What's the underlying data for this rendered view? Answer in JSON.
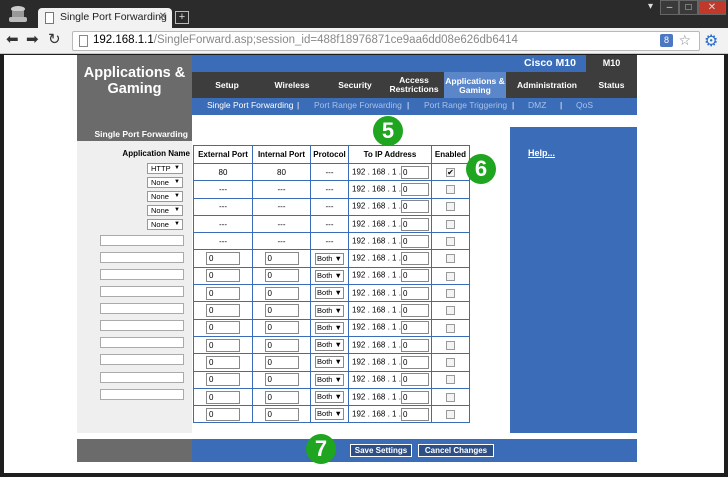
{
  "browser": {
    "tab_title": "Single Port Forwarding",
    "url_host": "192.168.1.1",
    "url_path": "/SingleForward.asp;session_id=488f18976871ce9aa6dd08e626db6414",
    "extension_label": "8"
  },
  "router": {
    "section_title": "Applications & Gaming",
    "model": "Cisco M10",
    "model_short": "M10",
    "menu": [
      {
        "label": "Setup"
      },
      {
        "label": "Wireless"
      },
      {
        "label": "Security"
      },
      {
        "label": "Access Restrictions"
      },
      {
        "label": "Applications & Gaming"
      },
      {
        "label": "Administration"
      },
      {
        "label": "Status"
      }
    ],
    "submenu": [
      {
        "label": "Single Port Forwarding"
      },
      {
        "label": "Port Range Forwarding"
      },
      {
        "label": "Port Range Triggering"
      },
      {
        "label": "DMZ"
      },
      {
        "label": "QoS"
      }
    ],
    "submenu_separator": "|",
    "left_heading": "Single Port Forwarding",
    "app_name_label": "Application Name",
    "app_selects": [
      "HTTP",
      "None",
      "None",
      "None",
      "None"
    ],
    "help_label": "Help...",
    "save_label": "Save Settings",
    "cancel_label": "Cancel Changes"
  },
  "table": {
    "headers": [
      "External Port",
      "Internal Port",
      "Protocol",
      "To IP Address",
      "Enabled"
    ],
    "ip_prefix": "192 . 168 . 1 .",
    "preset_rows": [
      {
        "ext": "80",
        "int": "80",
        "proto": "---",
        "ip_last": "0",
        "enabled": true
      },
      {
        "ext": "---",
        "int": "---",
        "proto": "---",
        "ip_last": "0",
        "enabled": false
      },
      {
        "ext": "---",
        "int": "---",
        "proto": "---",
        "ip_last": "0",
        "enabled": false
      },
      {
        "ext": "---",
        "int": "---",
        "proto": "---",
        "ip_last": "0",
        "enabled": false
      },
      {
        "ext": "---",
        "int": "---",
        "proto": "---",
        "ip_last": "0",
        "enabled": false
      }
    ],
    "custom_rows": [
      {
        "ext": "0",
        "int": "0",
        "proto": "Both",
        "ip_last": "0",
        "enabled": false
      },
      {
        "ext": "0",
        "int": "0",
        "proto": "Both",
        "ip_last": "0",
        "enabled": false
      },
      {
        "ext": "0",
        "int": "0",
        "proto": "Both",
        "ip_last": "0",
        "enabled": false
      },
      {
        "ext": "0",
        "int": "0",
        "proto": "Both",
        "ip_last": "0",
        "enabled": false
      },
      {
        "ext": "0",
        "int": "0",
        "proto": "Both",
        "ip_last": "0",
        "enabled": false
      },
      {
        "ext": "0",
        "int": "0",
        "proto": "Both",
        "ip_last": "0",
        "enabled": false
      },
      {
        "ext": "0",
        "int": "0",
        "proto": "Both",
        "ip_last": "0",
        "enabled": false
      },
      {
        "ext": "0",
        "int": "0",
        "proto": "Both",
        "ip_last": "0",
        "enabled": false
      },
      {
        "ext": "0",
        "int": "0",
        "proto": "Both",
        "ip_last": "0",
        "enabled": false
      },
      {
        "ext": "0",
        "int": "0",
        "proto": "Both",
        "ip_last": "0",
        "enabled": false
      }
    ],
    "checkmark": "✔"
  },
  "badges": [
    "5",
    "6",
    "7"
  ],
  "colors": {
    "router_blue": "#3a6cb7",
    "router_gray": "#6b6b6b",
    "menu_active": "#5b86c9",
    "badge_green": "#1fa51f"
  }
}
